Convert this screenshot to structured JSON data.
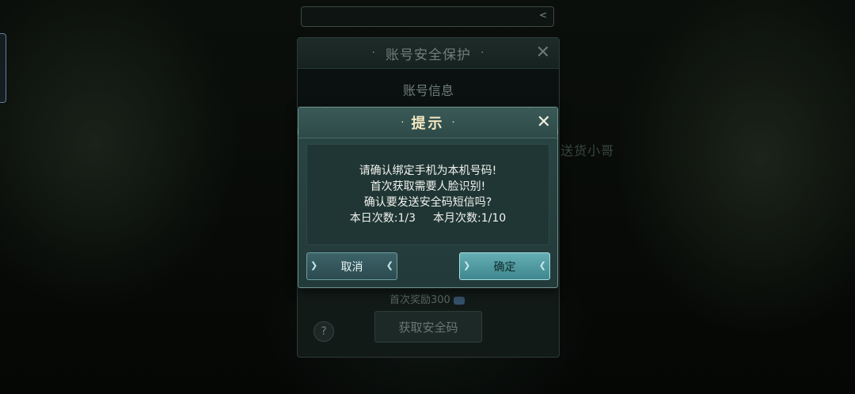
{
  "top_bar": {
    "share_icon": "share-icon"
  },
  "background_panel": {
    "title": "账号安全保护",
    "section_title": "账号信息",
    "reward_text": "首次奖励300",
    "help_label": "?",
    "get_code_label": "获取安全码"
  },
  "side_label": "送货小哥",
  "dialog": {
    "title": "提示",
    "title_dot": "·",
    "close_glyph": "✕",
    "lines": [
      "请确认绑定手机为本机号码!",
      "首次获取需要人脸识别!",
      "确认要发送安全码短信吗?"
    ],
    "daily_count": "本日次数:1/3",
    "monthly_count": "本月次数:1/10",
    "cancel_label": "取消",
    "confirm_label": "确定"
  },
  "colors": {
    "dialog_bg": "#2a4644",
    "title_text": "#f4e9c2",
    "confirm_button": "#64aeb4",
    "cancel_button": "#3c6368"
  }
}
